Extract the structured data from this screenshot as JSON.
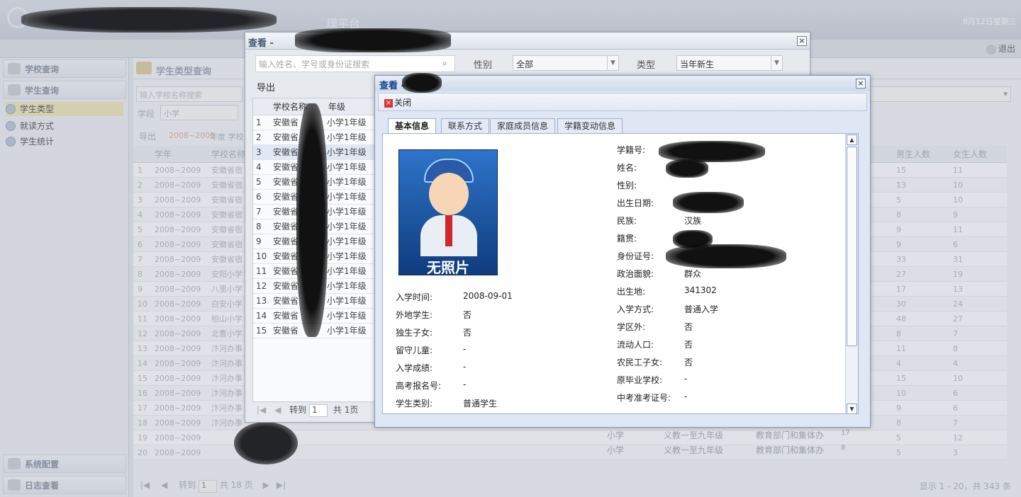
{
  "header": {
    "title": "理平台",
    "date": "8月12日星期三",
    "logout": "退出"
  },
  "sidebar": {
    "sections": [
      {
        "label": "学校查询"
      },
      {
        "label": "学生查询"
      }
    ],
    "items": [
      {
        "label": "学生类型"
      },
      {
        "label": "就读方式"
      },
      {
        "label": "学生统计"
      }
    ],
    "bottom": [
      {
        "label": "系统配置"
      },
      {
        "label": "日志查看"
      }
    ]
  },
  "main": {
    "title": "学生类型查询",
    "school_search_placeholder": "输入学校名称搜索",
    "stage_label": "学段",
    "stage_value": "小学",
    "export": "导出",
    "year_hint": "2008~2009",
    "year_suffix": "年度 学校",
    "headers": [
      "学年",
      "学校名称"
    ],
    "right_headers": [
      "男生人数",
      "女生人数"
    ],
    "rows": [
      [
        "1",
        "2008~2009",
        "安徽省宿",
        "15",
        "11"
      ],
      [
        "2",
        "2008~2009",
        "安徽省宿",
        "13",
        "10"
      ],
      [
        "3",
        "2008~2009",
        "安徽省宿",
        "5",
        "10"
      ],
      [
        "4",
        "2008~2009",
        "安徽省宿",
        "8",
        "9"
      ],
      [
        "5",
        "2008~2009",
        "安徽省宿",
        "9",
        "11"
      ],
      [
        "6",
        "2008~2009",
        "安徽省宿",
        "9",
        "6"
      ],
      [
        "7",
        "2008~2009",
        "安徽省宿",
        "33",
        "31"
      ],
      [
        "8",
        "2008~2009",
        "安阳小学",
        "27",
        "19"
      ],
      [
        "9",
        "2008~2009",
        "八里小学",
        "17",
        "13"
      ],
      [
        "10",
        "2008~2009",
        "白安小学",
        "30",
        "24"
      ],
      [
        "11",
        "2008~2009",
        "柏山小学",
        "48",
        "27"
      ],
      [
        "12",
        "2008~2009",
        "北曹小学",
        "8",
        "7"
      ],
      [
        "13",
        "2008~2009",
        "汴河办事",
        "11",
        "8"
      ],
      [
        "14",
        "2008~2009",
        "汴河办事",
        "4",
        "4"
      ],
      [
        "15",
        "2008~2009",
        "汴河办事",
        "15",
        "10"
      ],
      [
        "16",
        "2008~2009",
        "汴河办事",
        "10",
        "6"
      ],
      [
        "17",
        "2008~2009",
        "汴河办事",
        "9",
        "6"
      ],
      [
        "18",
        "2008~2009",
        "汴河办事",
        "8",
        "7"
      ],
      [
        "19",
        "2008~2009",
        "",
        "5",
        "12"
      ],
      [
        "20",
        "2008~2009",
        "",
        "5",
        "3"
      ]
    ],
    "extra_rows": [
      {
        "stage": "小学",
        "type": "义教一至九年级",
        "org": "教育部门和集体办",
        "n": "17"
      },
      {
        "stage": "小学",
        "type": "义教一至九年级",
        "org": "教育部门和集体办",
        "n": "8"
      }
    ],
    "pager": {
      "goto": "转到",
      "page": "1",
      "total": "共 18 页",
      "display": "显示 1 - 20，共 343 条"
    }
  },
  "win1": {
    "title": "查看 -",
    "search_placeholder": "输入姓名、学号或身份证搜索",
    "gender_label": "性别",
    "gender_value": "全部",
    "type_label": "类型",
    "type_value": "当年新生",
    "export": "导出",
    "headers": [
      "学校名称",
      "年级"
    ],
    "rows": [
      [
        "1",
        "安徽省",
        "小学1年级"
      ],
      [
        "2",
        "安徽省",
        "小学1年级"
      ],
      [
        "3",
        "安徽省",
        "小学1年级"
      ],
      [
        "4",
        "安徽省",
        "小学1年级"
      ],
      [
        "5",
        "安徽省",
        "小学1年级"
      ],
      [
        "6",
        "安徽省",
        "小学1年级"
      ],
      [
        "7",
        "安徽省",
        "小学1年级"
      ],
      [
        "8",
        "安徽省",
        "小学1年级"
      ],
      [
        "9",
        "安徽省",
        "小学1年级"
      ],
      [
        "10",
        "安徽省",
        "小学1年级"
      ],
      [
        "11",
        "安徽省",
        "小学1年级"
      ],
      [
        "12",
        "安徽省",
        "小学1年级"
      ],
      [
        "13",
        "安徽省",
        "小学1年级"
      ],
      [
        "14",
        "安徽省",
        "小学1年级"
      ],
      [
        "15",
        "安徽省",
        "小学1年级"
      ]
    ],
    "pager": {
      "goto": "转到",
      "page": "1",
      "total": "共",
      "pages": "1页"
    }
  },
  "win2": {
    "title": "查看 -",
    "close": "关闭",
    "tabs": [
      "基本信息",
      "联系方式",
      "家庭成员信息",
      "学籍变动信息"
    ],
    "photo_text": "无照片",
    "left_fields": [
      {
        "label": "入学时间:",
        "value": "2008-09-01"
      },
      {
        "label": "外地学生:",
        "value": "否"
      },
      {
        "label": "独生子女:",
        "value": "否"
      },
      {
        "label": "留守儿童:",
        "value": "-"
      },
      {
        "label": "入学成绩:",
        "value": "-"
      },
      {
        "label": "高考报名号:",
        "value": "-"
      },
      {
        "label": "学生类别:",
        "value": "普通学生"
      }
    ],
    "right_fields": [
      {
        "label": "学籍号:",
        "value": ""
      },
      {
        "label": "姓名:",
        "value": ""
      },
      {
        "label": "性别:",
        "value": ""
      },
      {
        "label": "出生日期:",
        "value": ""
      },
      {
        "label": "民族:",
        "value": "汉族"
      },
      {
        "label": "籍贯:",
        "value": ""
      },
      {
        "label": "身份证号:",
        "value": ""
      },
      {
        "label": "政治面貌:",
        "value": "群众"
      },
      {
        "label": "出生地:",
        "value": "341302"
      },
      {
        "label": "入学方式:",
        "value": "普通入学"
      },
      {
        "label": "学区外:",
        "value": "否"
      },
      {
        "label": "流动人口:",
        "value": "否"
      },
      {
        "label": "农民工子女:",
        "value": "否"
      },
      {
        "label": "原毕业学校:",
        "value": "-"
      },
      {
        "label": "中考准考证号:",
        "value": "-"
      }
    ]
  }
}
